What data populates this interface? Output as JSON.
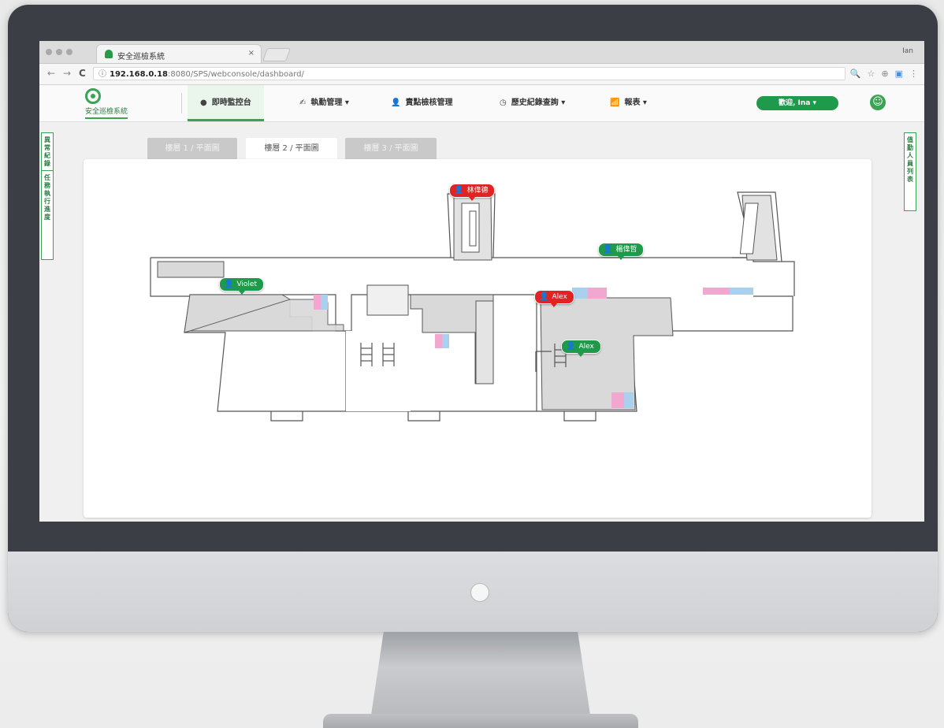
{
  "browser": {
    "tab_title": "安全巡檢系統",
    "tab_close": "×",
    "window_user": "Ian",
    "address": {
      "host": "192.168.0.18",
      "path": ":8080/SPS/webconsole/dashboard/"
    },
    "nav": {
      "back": "←",
      "forward": "→",
      "reload": "C"
    },
    "actions": [
      "zoom-icon",
      "star-icon",
      "extension-icon",
      "cast-icon",
      "menu-icon"
    ]
  },
  "app": {
    "logo_text": "安全巡檢系統",
    "menu": [
      {
        "label": "即時監控台",
        "icon": "●",
        "active": true
      },
      {
        "label": "執勤管理 ▾",
        "icon": "✍"
      },
      {
        "label": "責點檢核管理",
        "icon": "👤"
      },
      {
        "label": "歷史紀錄查詢 ▾",
        "icon": "◷"
      },
      {
        "label": "報表 ▾",
        "icon": "📶"
      }
    ],
    "welcome": "歡迎, Ina ▾",
    "settings_icon": "☺"
  },
  "side_tabs": {
    "left": [
      "異常紀錄",
      "任務執行進度"
    ],
    "right": "值勤人員列表"
  },
  "floor_tabs": [
    {
      "label": "樓層 1 / 平面圖",
      "active": false
    },
    {
      "label": "樓層 2 / 平面圖",
      "active": true
    },
    {
      "label": "樓層 3 / 平面圖",
      "active": false
    }
  ],
  "markers": [
    {
      "name": "林偉德",
      "status": "alert",
      "color": "#e12323"
    },
    {
      "name": "楊偉哲",
      "status": "normal",
      "color": "#1f9a4a"
    },
    {
      "name": "Violet",
      "status": "normal",
      "color": "#1f9a4a"
    },
    {
      "name": "Alex",
      "status": "alert",
      "color": "#e12323"
    },
    {
      "name": "Alex",
      "status": "normal",
      "color": "#1f9a4a"
    }
  ]
}
